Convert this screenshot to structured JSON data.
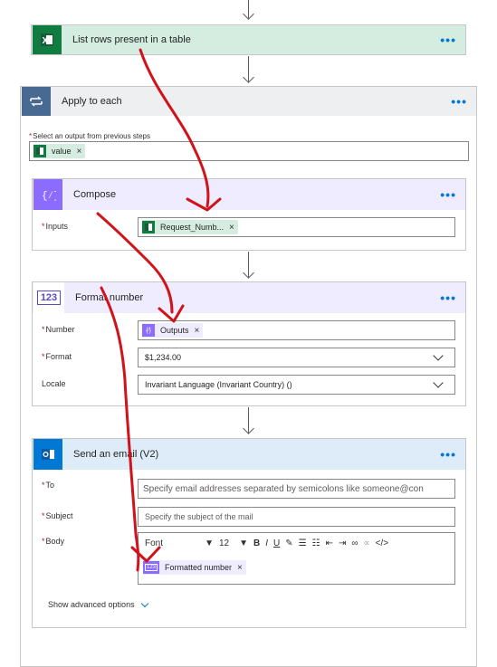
{
  "list_rows": {
    "title": "List rows present in a table",
    "more": "•••",
    "color": "#d5ece1",
    "icon": "excel-icon"
  },
  "apply_each": {
    "title": "Apply to each",
    "more": "•••",
    "select_label": "Select an output from previous steps",
    "token": "value",
    "token_color": "#d5ece1"
  },
  "compose": {
    "title": "Compose",
    "more": "•••",
    "inputs_label": "Inputs",
    "token": "Request_Numb...",
    "header_color": "#efecff"
  },
  "format_number": {
    "title": "Format number",
    "more": "•••",
    "badge": "123",
    "number_label": "Number",
    "number_token": "Outputs",
    "format_label": "Format",
    "format_value": "$1,234.00",
    "locale_label": "Locale",
    "locale_value": "Invariant Language (Invariant Country) ()",
    "header_color": "#efecff"
  },
  "send_email": {
    "title": "Send an email (V2)",
    "more": "•••",
    "to_label": "To",
    "to_placeholder": "Specify email addresses separated by semicolons like someone@con",
    "subject_label": "Subject",
    "subject_placeholder": "Specify the subject of the mail",
    "body_label": "Body",
    "font_value": "Font",
    "size_value": "12",
    "bold": "B",
    "italic": "I",
    "underline": "U",
    "body_token": "Formatted number",
    "body_token_badge": "123",
    "advanced": "Show advanced options",
    "header_color": "#deecf9"
  },
  "token_close": "×"
}
